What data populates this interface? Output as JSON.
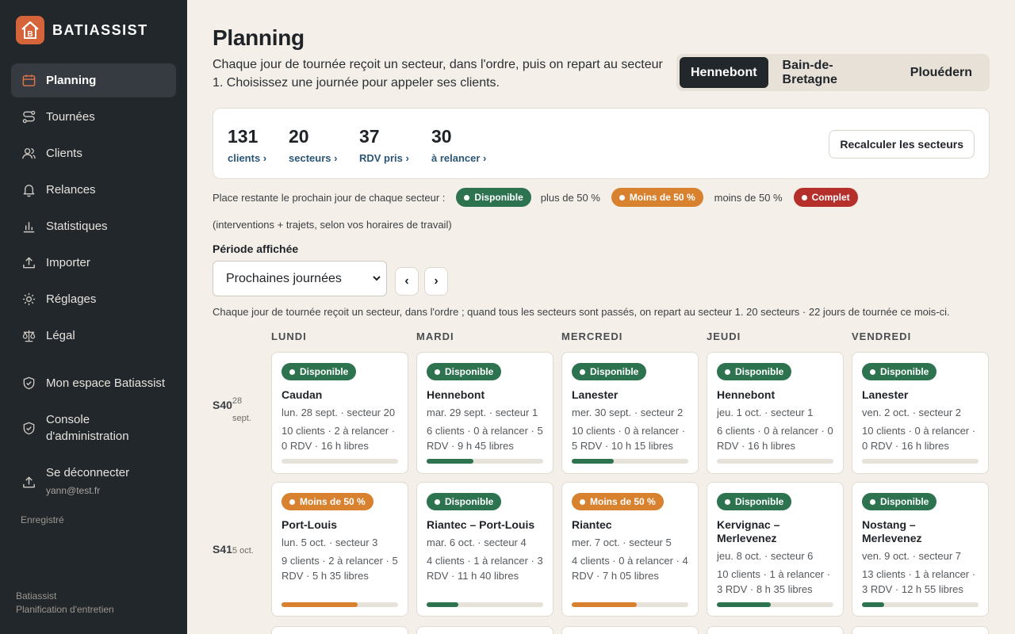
{
  "brand": {
    "name": "BATIASSIST",
    "logo_letter": "B",
    "accent": "#d6643a"
  },
  "sidebar": {
    "items": [
      {
        "label": "Planning",
        "icon": "calendar-icon",
        "active": true
      },
      {
        "label": "Tournées",
        "icon": "route-icon"
      },
      {
        "label": "Clients",
        "icon": "users-icon"
      },
      {
        "label": "Relances",
        "icon": "bell-icon"
      },
      {
        "label": "Statistiques",
        "icon": "bar-chart-icon"
      },
      {
        "label": "Importer",
        "icon": "upload-icon"
      },
      {
        "label": "Réglages",
        "icon": "sun-gear-icon"
      },
      {
        "label": "Légal",
        "icon": "scale-icon"
      }
    ],
    "space": {
      "label": "Mon espace Batiassist",
      "icon": "shield-check-icon"
    },
    "console": {
      "line1": "Console",
      "line2": "d'administration",
      "icon": "shield-check-icon"
    },
    "logout": {
      "label": "Se déconnecter",
      "email": "yann@test.fr",
      "icon": "logout-icon"
    },
    "saved": "Enregistré",
    "footer": {
      "line1": "Batiassist",
      "line2": "Planification d'entretien"
    }
  },
  "header": {
    "title": "Planning",
    "intro": "Chaque jour de tournée reçoit un secteur, dans l'ordre, puis on repart au secteur 1. Choisissez une journée pour appeler ses clients.",
    "tabs": [
      "Hennebont",
      "Bain-de-Bretagne",
      "Plouédern"
    ],
    "active_tab": "Hennebont"
  },
  "stats": {
    "items": [
      {
        "value": "131",
        "label": "clients ›"
      },
      {
        "value": "20",
        "label": "secteurs ›"
      },
      {
        "value": "37",
        "label": "RDV pris ›"
      },
      {
        "value": "30",
        "label": "à relancer ›"
      }
    ],
    "recalc_label": "Recalculer les secteurs"
  },
  "legend": {
    "intro": "Place restante le prochain jour de chaque secteur :",
    "available": "Disponible",
    "available_desc": "plus de 50 %",
    "less": "Moins de 50 %",
    "less_desc": "moins de 50 %",
    "full": "Complet",
    "note": "(interventions + trajets, selon vos horaires de travail)",
    "colors": {
      "green": "#2d7350",
      "orange": "#d8812e",
      "red": "#b5302a"
    }
  },
  "period": {
    "label": "Période affichée",
    "selected": "Prochaines journées",
    "prev": "‹",
    "next": "›",
    "help": "Chaque jour de tournée reçoit un secteur, dans l'ordre ; quand tous les secteurs sont passés, on repart au secteur 1. 20 secteurs · 22 jours de tournée ce mois-ci."
  },
  "days": [
    "LUNDI",
    "MARDI",
    "MERCREDI",
    "JEUDI",
    "VENDREDI"
  ],
  "weeks": [
    {
      "label": "S40",
      "date": "28",
      "date2": "sept.",
      "cards": [
        {
          "status": "Disponible",
          "level": "green",
          "title": "Caudan",
          "sub": "lun. 28 sept. · secteur 20",
          "meta": "10 clients · 2 à relancer · 0 RDV · 16 h libres",
          "fill": 0
        },
        {
          "status": "Disponible",
          "level": "green",
          "title": "Hennebont",
          "sub": "mar. 29 sept. · secteur 1",
          "meta": "6 clients · 0 à relancer · 5 RDV · 9 h 45 libres",
          "fill": 0.4
        },
        {
          "status": "Disponible",
          "level": "green",
          "title": "Lanester",
          "sub": "mer. 30 sept. · secteur 2",
          "meta": "10 clients · 0 à relancer · 5 RDV · 10 h 15 libres",
          "fill": 0.36
        },
        {
          "status": "Disponible",
          "level": "green",
          "title": "Hennebont",
          "sub": "jeu. 1 oct. · secteur 1",
          "meta": "6 clients · 0 à relancer · 0 RDV · 16 h libres",
          "fill": 0
        },
        {
          "status": "Disponible",
          "level": "green",
          "title": "Lanester",
          "sub": "ven. 2 oct. · secteur 2",
          "meta": "10 clients · 0 à relancer · 0 RDV · 16 h libres",
          "fill": 0
        }
      ]
    },
    {
      "label": "S41",
      "date": "5 oct.",
      "date2": "",
      "cards": [
        {
          "status": "Moins de 50 %",
          "level": "orange",
          "title": "Port-Louis",
          "sub": "lun. 5 oct. · secteur 3",
          "meta": "9 clients · 2 à relancer · 5 RDV · 5 h 35 libres",
          "fill": 0.65
        },
        {
          "status": "Disponible",
          "level": "green",
          "title": "Riantec – Port-Louis",
          "sub": "mar. 6 oct. · secteur 4",
          "meta": "4 clients · 1 à relancer · 3 RDV · 11 h 40 libres",
          "fill": 0.27
        },
        {
          "status": "Moins de 50 %",
          "level": "orange",
          "title": "Riantec",
          "sub": "mer. 7 oct. · secteur 5",
          "meta": "4 clients · 0 à relancer · 4 RDV · 7 h 05 libres",
          "fill": 0.56
        },
        {
          "status": "Disponible",
          "level": "green",
          "title": "Kervignac – Merlevenez",
          "sub": "jeu. 8 oct. · secteur 6",
          "meta": "10 clients · 1 à relancer · 3 RDV · 8 h 35 libres",
          "fill": 0.46
        },
        {
          "status": "Disponible",
          "level": "green",
          "title": "Nostang – Merlevenez",
          "sub": "ven. 9 oct. · secteur 7",
          "meta": "13 clients · 1 à relancer · 3 RDV · 12 h 55 libres",
          "fill": 0.19
        }
      ]
    }
  ]
}
